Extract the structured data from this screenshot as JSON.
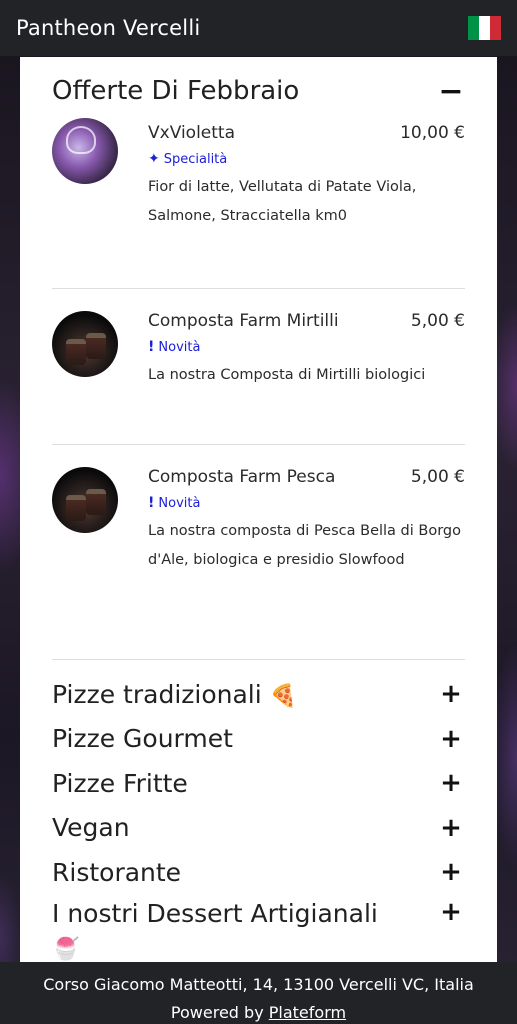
{
  "header": {
    "title": "Pantheon Vercelli",
    "flag_colors": [
      "#009246",
      "#ffffff",
      "#ce2b37"
    ]
  },
  "offers": {
    "title": "Offerte Di Febbraio",
    "toggle": "−",
    "items": [
      {
        "name": "VxVioletta",
        "price": "10,00 €",
        "tag_icon": "✦",
        "tag": "Specialità",
        "description": "Fior di latte, Vellutata di Patate Viola, Salmone, Stracciatella km0"
      },
      {
        "name": "Composta Farm Mirtilli",
        "price": "5,00 €",
        "tag_icon": "!",
        "tag": "Novità",
        "description": "La nostra Composta di Mirtilli biologici"
      },
      {
        "name": "Composta Farm Pesca",
        "price": "5,00 €",
        "tag_icon": "!",
        "tag": "Novità",
        "description": "La nostra composta di Pesca Bella di Borgo d'Ale, biologica e presidio Slowfood"
      }
    ]
  },
  "categories": [
    {
      "title": "Pizze tradizionali",
      "emoji": "🍕",
      "toggle": "+"
    },
    {
      "title": "Pizze Gourmet",
      "emoji": "",
      "toggle": "+"
    },
    {
      "title": "Pizze Fritte",
      "emoji": "",
      "toggle": "+"
    },
    {
      "title": "Vegan",
      "emoji": "",
      "toggle": "+"
    },
    {
      "title": "Ristorante",
      "emoji": "",
      "toggle": "+"
    },
    {
      "title": "I nostri Dessert Artigianali",
      "emoji": "🍧",
      "toggle": "+"
    }
  ],
  "footer": {
    "address": "Corso Giacomo Matteotti, 14, 13100 Vercelli VC, Italia",
    "powered_prefix": "Powered by",
    "powered_link": "Plateform"
  },
  "colors": {
    "accent_tag": "#1c21d8",
    "bar": "#212327"
  }
}
